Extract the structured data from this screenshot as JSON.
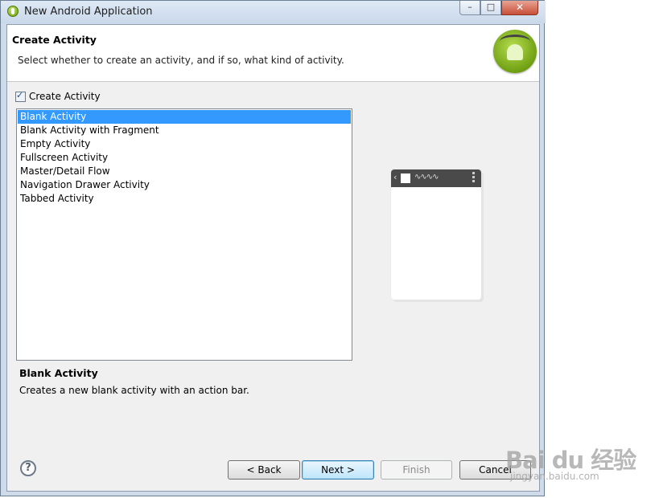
{
  "window": {
    "title": "New Android Application",
    "minimize": "–",
    "maximize": "□",
    "close": "✕"
  },
  "header": {
    "title": "Create Activity",
    "description": "Select whether to create an activity, and if so, what kind of activity."
  },
  "create_activity": {
    "label": "Create Activity",
    "checked": true
  },
  "activities": [
    "Blank Activity",
    "Blank Activity with Fragment",
    "Empty Activity",
    "Fullscreen Activity",
    "Master/Detail Flow",
    "Navigation Drawer Activity",
    "Tabbed Activity"
  ],
  "selected_activity": "Blank Activity",
  "preview": {
    "back_glyph": "‹",
    "title_glyph": "∿∿∿∿"
  },
  "description": {
    "title": "Blank Activity",
    "text": "Creates a new blank activity with an action bar."
  },
  "buttons": {
    "help": "?",
    "back": "< Back",
    "next": "Next >",
    "finish": "Finish",
    "cancel": "Cancel"
  },
  "watermark": {
    "main": "Bai du 经验",
    "sub": "jingyan.baidu.com"
  },
  "colors": {
    "selection": "#3399ff",
    "android_green": "#a4c639"
  }
}
